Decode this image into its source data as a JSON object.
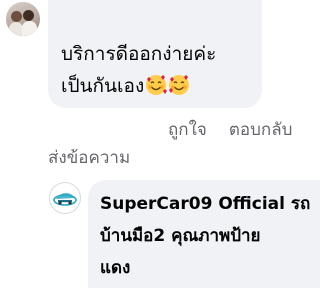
{
  "comment_1": {
    "text_line_1": "บริการดีออกง่ายค่ะ",
    "text_line_2": "เป็นกันเอง",
    "emoji": "smiling-face-with-hearts",
    "like_label": "ถูกใจ",
    "reply_label": "ตอบกลับ",
    "send_message_label": "ส่งข้อความ"
  },
  "comment_2": {
    "author": "SuperCar09 Official",
    "text_inline": "รถ",
    "text_line_2": "บ้านมือ2 คุณภาพป้าย",
    "text_line_3": "แดง"
  },
  "colors": {
    "bubble_bg": "#f0f2f5",
    "text": "#050505",
    "secondary_text": "#65676b"
  }
}
